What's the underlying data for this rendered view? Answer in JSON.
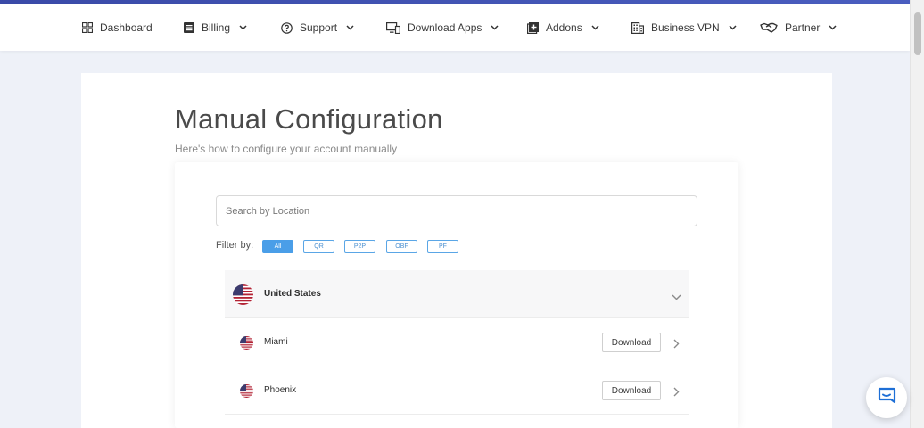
{
  "nav": {
    "items": [
      {
        "label": "Dashboard",
        "icon": "dashboard-icon",
        "has_dropdown": false
      },
      {
        "label": "Billing",
        "icon": "billing-icon",
        "has_dropdown": true
      },
      {
        "label": "Support",
        "icon": "support-icon",
        "has_dropdown": true
      },
      {
        "label": "Download Apps",
        "icon": "monitor-icon",
        "has_dropdown": true
      },
      {
        "label": "Addons",
        "icon": "add-box-icon",
        "has_dropdown": true
      },
      {
        "label": "Business VPN",
        "icon": "building-icon",
        "has_dropdown": true
      },
      {
        "label": "Partner",
        "icon": "handshake-icon",
        "has_dropdown": true
      }
    ]
  },
  "main": {
    "title": "Manual Configuration",
    "subtitle": "Here's how to configure your account manually"
  },
  "search": {
    "placeholder": "Search by Location",
    "value": ""
  },
  "filter": {
    "label": "Filter by:",
    "options": [
      "All",
      "QR",
      "P2P",
      "OBF",
      "PF"
    ],
    "selected": "All"
  },
  "locations": {
    "country": {
      "name": "United States",
      "flag": "us-flag",
      "expanded": true
    },
    "cities": [
      {
        "name": "Miami",
        "action": "Download"
      },
      {
        "name": "Phoenix",
        "action": "Download"
      }
    ]
  },
  "colors": {
    "accent_bar": "#3a4aa8",
    "filter_active": "#4a9ee8",
    "chat_icon": "#1e6fd6",
    "background": "#eef1f8"
  }
}
